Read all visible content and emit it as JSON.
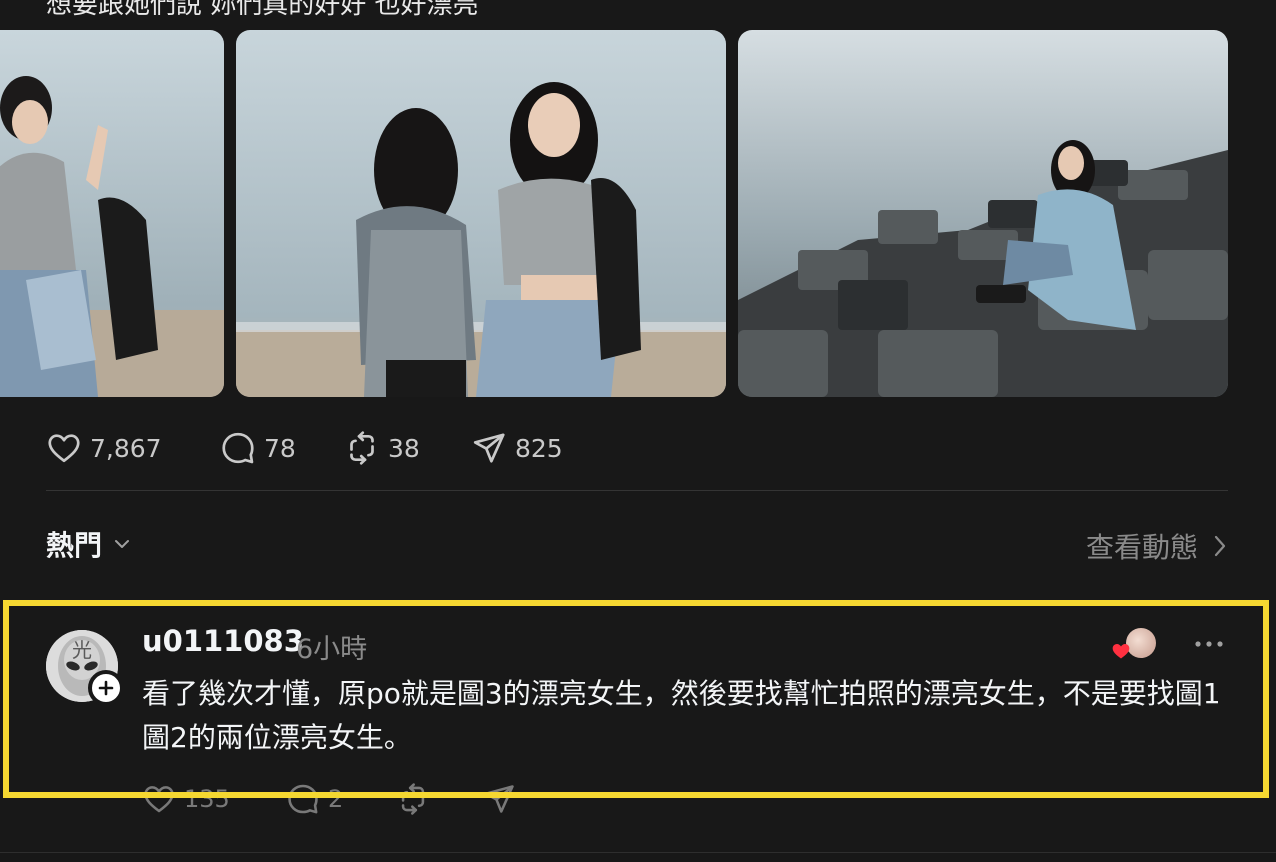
{
  "post": {
    "caption_partial": "想要跟她們說 妳們真的好好 也好漂亮",
    "photos": [
      {
        "name": "photo-two-girls-peace-sign"
      },
      {
        "name": "photo-two-girls-beach"
      },
      {
        "name": "photo-girl-sitting-tetrapods"
      }
    ],
    "actions": {
      "likes": "7,867",
      "comments": "78",
      "reposts": "38",
      "shares": "825"
    }
  },
  "replies_header": {
    "sort_label": "熱門",
    "activity_label": "查看動態"
  },
  "comment": {
    "username": "u0111083",
    "timestamp": "6小時",
    "avatar_glyph": "光",
    "text": "看了幾次才懂，原po就是圖3的漂亮女生，然後要找幫忙拍照的漂亮女生，不是要找圖1圖2的兩位漂亮女生。",
    "actions": {
      "likes": "135",
      "comments": "2"
    }
  },
  "colors": {
    "background": "#181818",
    "highlight": "#f5d731",
    "liked_heart": "#ff3040"
  }
}
